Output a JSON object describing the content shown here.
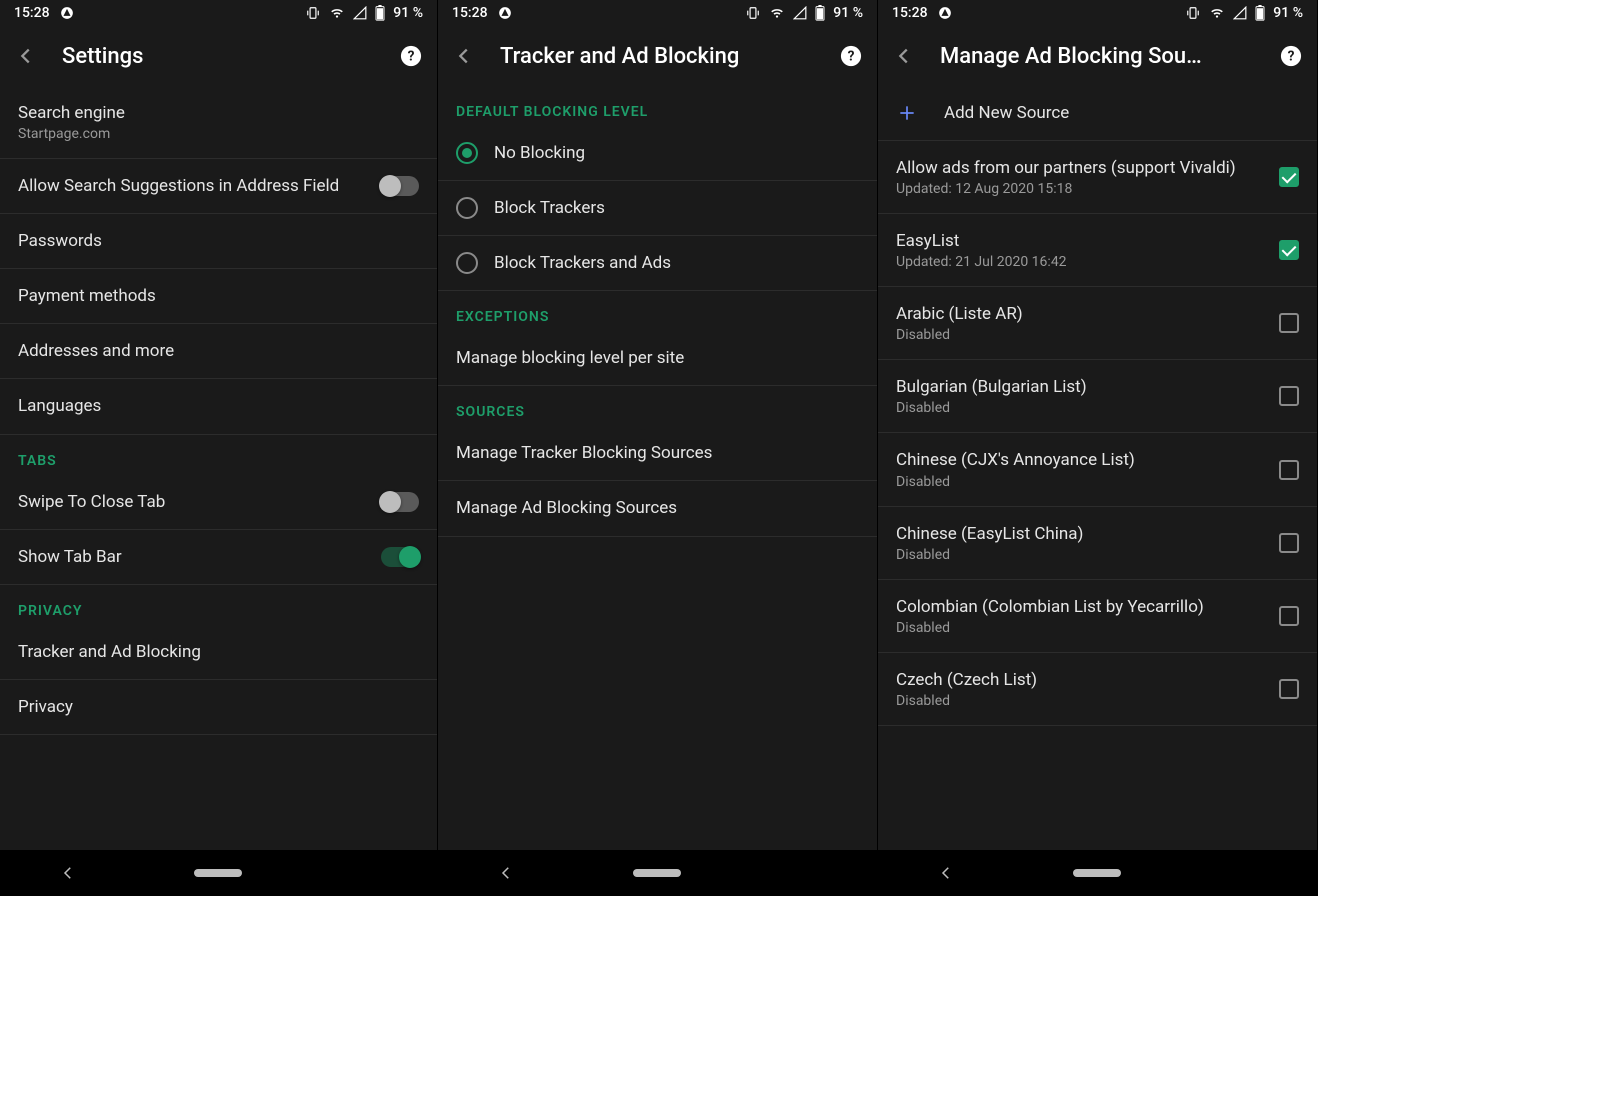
{
  "status": {
    "time": "15:28",
    "battery": "91 %"
  },
  "screen1": {
    "title": "Settings",
    "items": [
      {
        "primary": "Search engine",
        "secondary": "Startpage.com",
        "type": "link"
      },
      {
        "primary": "Allow Search Suggestions in Address Field",
        "type": "toggle",
        "on": false
      },
      {
        "primary": "Passwords",
        "type": "link"
      },
      {
        "primary": "Payment methods",
        "type": "link"
      },
      {
        "primary": "Addresses and more",
        "type": "link"
      },
      {
        "primary": "Languages",
        "type": "link"
      }
    ],
    "sections": [
      {
        "header": "TABS",
        "items": [
          {
            "primary": "Swipe To Close Tab",
            "type": "toggle",
            "on": false
          },
          {
            "primary": "Show Tab Bar",
            "type": "toggle",
            "on": true
          }
        ]
      },
      {
        "header": "PRIVACY",
        "items": [
          {
            "primary": "Tracker and Ad Blocking",
            "type": "link"
          },
          {
            "primary": "Privacy",
            "type": "link"
          }
        ]
      }
    ]
  },
  "screen2": {
    "title": "Tracker and Ad Blocking",
    "sections": [
      {
        "header": "DEFAULT BLOCKING LEVEL",
        "items": [
          {
            "primary": "No Blocking",
            "type": "radio",
            "selected": true
          },
          {
            "primary": "Block Trackers",
            "type": "radio",
            "selected": false
          },
          {
            "primary": "Block Trackers and Ads",
            "type": "radio",
            "selected": false
          }
        ]
      },
      {
        "header": "EXCEPTIONS",
        "items": [
          {
            "primary": "Manage blocking level per site",
            "type": "link"
          }
        ]
      },
      {
        "header": "SOURCES",
        "items": [
          {
            "primary": "Manage Tracker Blocking Sources",
            "type": "link"
          },
          {
            "primary": "Manage Ad Blocking Sources",
            "type": "link"
          }
        ]
      }
    ]
  },
  "screen3": {
    "title": "Manage Ad Blocking Sou…",
    "addLabel": "Add New Source",
    "items": [
      {
        "primary": "Allow ads from our partners (support Vivaldi)",
        "secondary": "Updated: 12 Aug 2020 15:18",
        "checked": true
      },
      {
        "primary": "EasyList",
        "secondary": "Updated: 21 Jul 2020 16:42",
        "checked": true
      },
      {
        "primary": "Arabic (Liste AR)",
        "secondary": "Disabled",
        "checked": false
      },
      {
        "primary": "Bulgarian (Bulgarian List)",
        "secondary": "Disabled",
        "checked": false
      },
      {
        "primary": "Chinese (CJX's Annoyance List)",
        "secondary": "Disabled",
        "checked": false
      },
      {
        "primary": "Chinese (EasyList China)",
        "secondary": "Disabled",
        "checked": false
      },
      {
        "primary": "Colombian (Colombian List by Yecarrillo)",
        "secondary": "Disabled",
        "checked": false
      },
      {
        "primary": "Czech (Czech List)",
        "secondary": "Disabled",
        "checked": false
      }
    ]
  }
}
